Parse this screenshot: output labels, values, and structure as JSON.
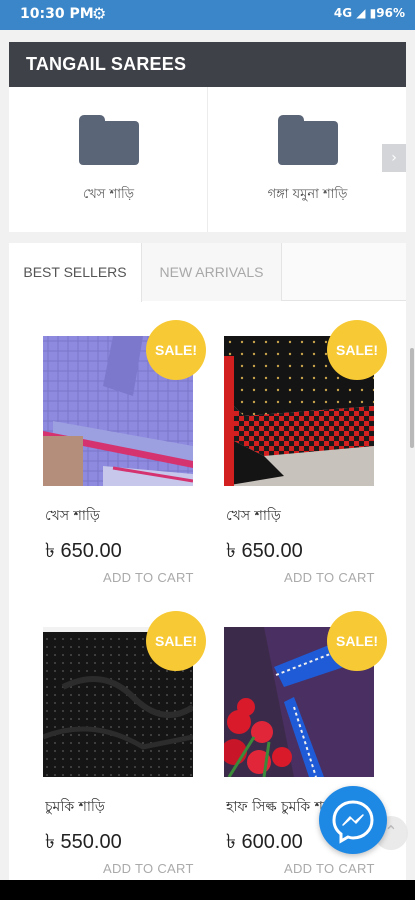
{
  "status_bar": {
    "time": "10:30 PM",
    "battery": "96%",
    "network": "4G"
  },
  "category": {
    "title": "TANGAIL SAREES",
    "items": [
      {
        "label": "খেস শাড়ি",
        "icon": "folder-icon"
      },
      {
        "label": "গঙ্গা যমুনা শাড়ি",
        "icon": "folder-icon"
      }
    ],
    "next_icon": "chevron-right-icon"
  },
  "products": {
    "tabs": [
      {
        "label": "BEST SELLERS",
        "active": true
      },
      {
        "label": "NEW ARRIVALS",
        "active": false
      }
    ],
    "items": [
      {
        "name": "খেস শাড়ি",
        "price": "৳ 650.00",
        "badge": "SALE!",
        "cart": "ADD TO CART"
      },
      {
        "name": "খেস শাড়ি",
        "price": "৳ 650.00",
        "badge": "SALE!",
        "cart": "ADD TO CART"
      },
      {
        "name": "চুমকি শাড়ি",
        "price": "৳ 550.00",
        "badge": "SALE!",
        "cart": "ADD TO CART"
      },
      {
        "name": "হাফ সিল্ক চুমকি শাড়ি",
        "price": "৳ 600.00",
        "badge": "SALE!",
        "cart": "ADD TO CART"
      }
    ]
  },
  "colors": {
    "status_bar": "#3a86c8",
    "header_bg": "#3e4147",
    "sale_badge": "#f7c934",
    "messenger": "#1e88e5"
  }
}
